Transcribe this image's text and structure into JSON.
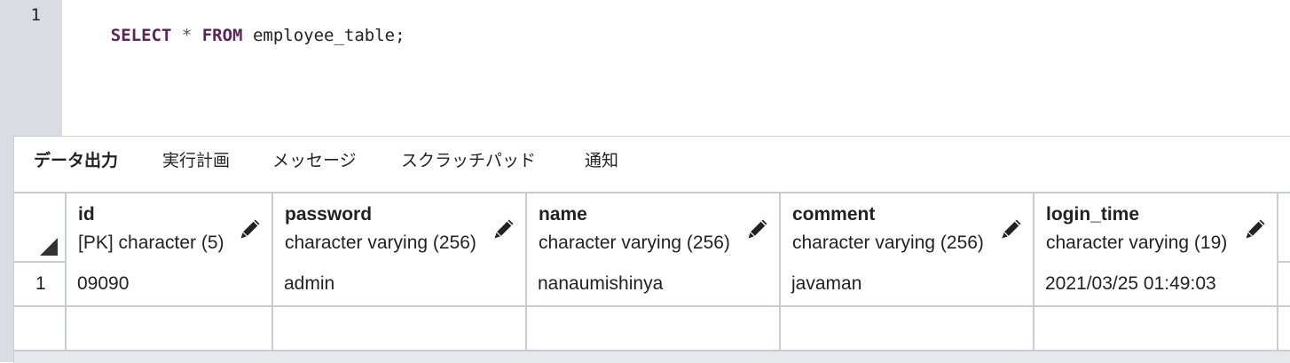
{
  "editor": {
    "line_number": "1",
    "code": {
      "kw1": "SELECT",
      "star": " * ",
      "kw2": "FROM",
      "rest": " employee_table;"
    }
  },
  "tabs": [
    {
      "label": "データ出力",
      "active": true
    },
    {
      "label": "実行計画",
      "active": false
    },
    {
      "label": "メッセージ",
      "active": false
    },
    {
      "label": "スクラッチパッド",
      "active": false
    },
    {
      "label": "通知",
      "active": false
    }
  ],
  "columns": [
    {
      "name": "id",
      "type": "[PK] character (5)",
      "icon": "pencil-icon"
    },
    {
      "name": "password",
      "type": "character varying (256)",
      "icon": "pencil-icon"
    },
    {
      "name": "name",
      "type": "character varying (256)",
      "icon": "pencil-icon"
    },
    {
      "name": "comment",
      "type": "character varying (256)",
      "icon": "pencil-icon"
    },
    {
      "name": "login_time",
      "type": "character varying (19)",
      "icon": "pencil-icon"
    }
  ],
  "rows": [
    {
      "num": "1",
      "cells": [
        "09090",
        "admin",
        "nanaumishinya",
        "javaman",
        "2021/03/25 01:49:03"
      ]
    },
    {
      "num": "",
      "cells": [
        "",
        "",
        "",
        "",
        ""
      ]
    }
  ],
  "colors": {
    "keyword": "#5b2458",
    "gutter": "#d9dce3",
    "grid_border": "#c8ccd4"
  }
}
